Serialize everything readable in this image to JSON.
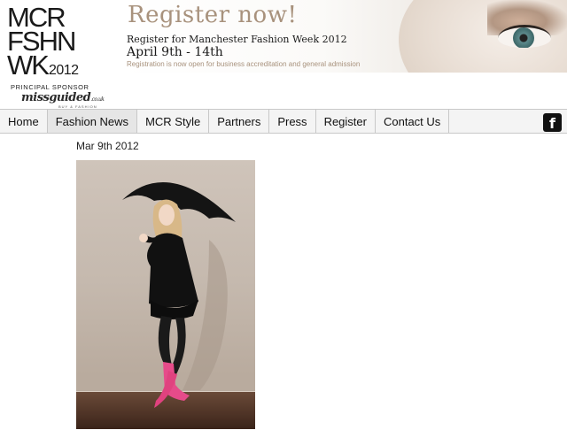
{
  "logo": {
    "lines": [
      "MCR",
      "FSHN",
      "WK"
    ],
    "year": "2012",
    "sponsor_label": "PRINCIPAL SPONSOR",
    "sponsor_brand": "missguided",
    "sponsor_brand_suffix": ".co.uk",
    "sponsor_sub": "BUY & FASHION"
  },
  "banner": {
    "title": "Register now!",
    "subtitle": "Register for Manchester Fashion Week 2012",
    "dates": "April 9th - 14th",
    "note": "Registration is now open for business accreditation and general admission"
  },
  "nav": {
    "items": [
      {
        "label": "Home"
      },
      {
        "label": "Fashion News"
      },
      {
        "label": "MCR Style"
      },
      {
        "label": "Partners"
      },
      {
        "label": "Press"
      },
      {
        "label": "Register"
      },
      {
        "label": "Contact Us"
      }
    ],
    "active_index": 1,
    "facebook_glyph": "f"
  },
  "post": {
    "date": "Mar 9th 2012"
  },
  "colors": {
    "accent": "#a8927d",
    "boots": "#e64b8a"
  }
}
